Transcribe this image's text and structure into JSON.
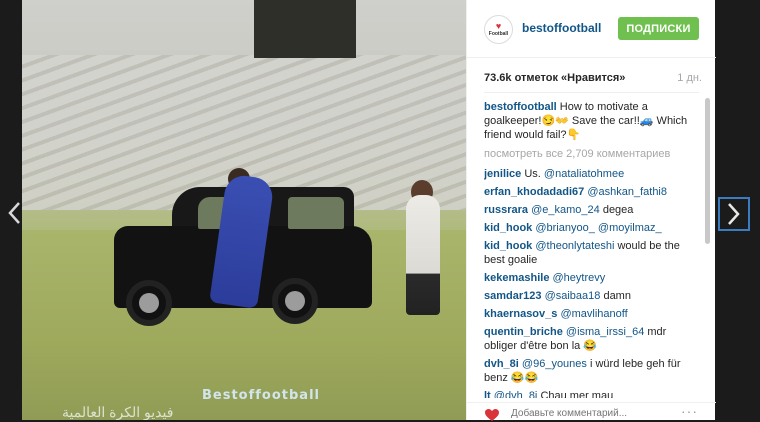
{
  "post": {
    "watermark": "Bestoffootball",
    "caption_overlay": "ﻓﻴﺪﻳﻮ ﺍﻟﻜﺮﺓ ﺍﻟﻌﺎﻟﻤﻴﺔ"
  },
  "header": {
    "username": "bestoffootball",
    "follow_label": "ПОДПИСКИ",
    "avatar_text": "Football"
  },
  "stats": {
    "likes": "73.6k отметок «Нравится»",
    "age": "1 дн."
  },
  "caption": {
    "user": "bestoffootball",
    "text": "How to motivate a goalkeeper!😏👐 Save the car!!🚙 Which friend would fail?👇"
  },
  "view_all": "посмотреть все 2,709 комментариев",
  "comments": [
    {
      "user": "jenilice",
      "parts": [
        {
          "t": "text",
          "v": "Us. "
        },
        {
          "t": "mention",
          "v": "@nataliatohmee"
        }
      ]
    },
    {
      "user": "erfan_khodadadi67",
      "parts": [
        {
          "t": "mention",
          "v": "@ashkan_fathi8"
        }
      ]
    },
    {
      "user": "russrara",
      "parts": [
        {
          "t": "mention",
          "v": "@e_kamo_24"
        },
        {
          "t": "text",
          "v": " degea"
        }
      ]
    },
    {
      "user": "kid_hook",
      "parts": [
        {
          "t": "mention",
          "v": "@brianyoo_"
        },
        {
          "t": "text",
          "v": " "
        },
        {
          "t": "mention",
          "v": "@moyilmaz_"
        }
      ]
    },
    {
      "user": "kid_hook",
      "parts": [
        {
          "t": "mention",
          "v": "@theonlytateshi"
        },
        {
          "t": "text",
          "v": " would be the best goalie"
        }
      ]
    },
    {
      "user": "kekemashile",
      "parts": [
        {
          "t": "mention",
          "v": "@heytrevy"
        }
      ]
    },
    {
      "user": "samdar123",
      "parts": [
        {
          "t": "mention",
          "v": "@saibaa18"
        },
        {
          "t": "text",
          "v": " damn"
        }
      ]
    },
    {
      "user": "khaernasov_s",
      "parts": [
        {
          "t": "mention",
          "v": "@mavlihanoff"
        }
      ]
    },
    {
      "user": "quentin_briche",
      "parts": [
        {
          "t": "mention",
          "v": "@isma_irssi_64"
        },
        {
          "t": "text",
          "v": " mdr obliger d'être bon la 😂"
        }
      ]
    },
    {
      "user": "dvh_8i",
      "parts": [
        {
          "t": "mention",
          "v": "@96_younes"
        },
        {
          "t": "text",
          "v": " i würd lebe geh für benz 😂😂"
        }
      ]
    },
    {
      "user": "lt",
      "parts": [
        {
          "t": "mention",
          "v": "@dvh_8i"
        },
        {
          "t": "text",
          "v": " Chau mer mau"
        }
      ]
    }
  ],
  "footer": {
    "comment_placeholder": "Добавьте комментарий...",
    "more_label": "···"
  },
  "colors": {
    "accent": "#125688",
    "follow": "#70c050",
    "heart": "#d9343a"
  }
}
